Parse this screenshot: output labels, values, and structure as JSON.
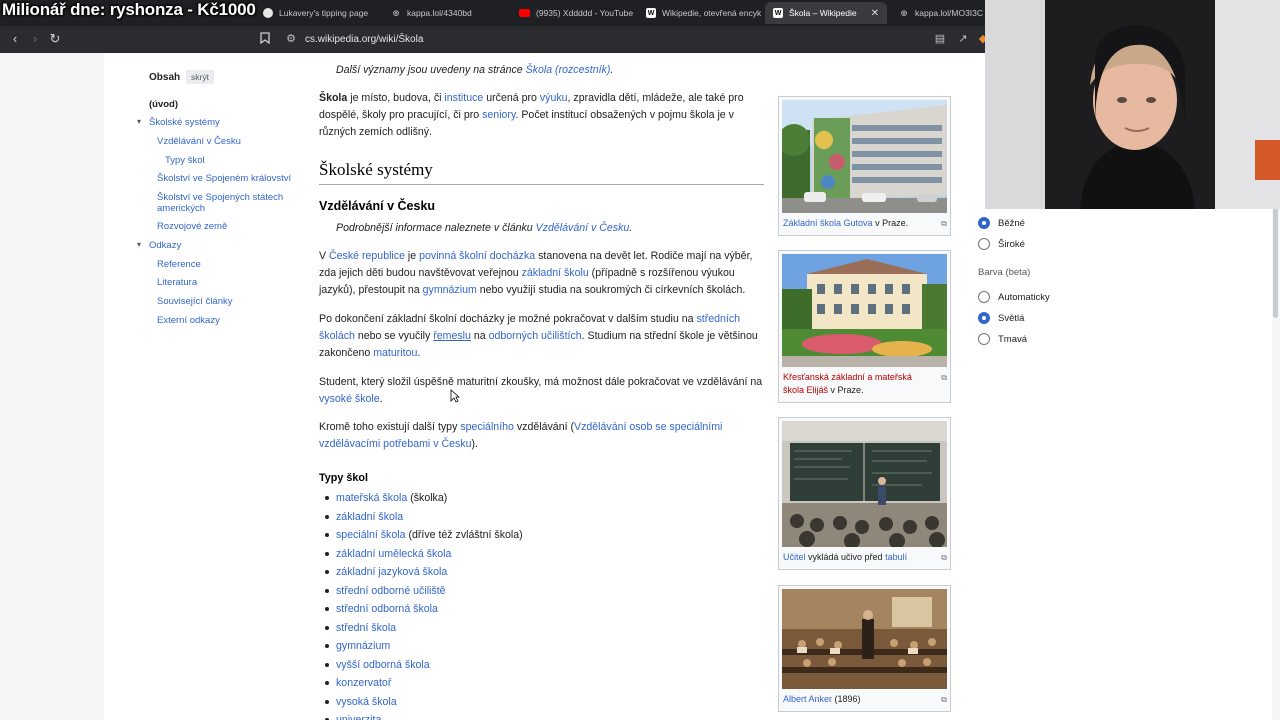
{
  "stream_title": "Milionář dne: ryshonza - Kč1000",
  "tabs": [
    {
      "label": "Lukavery's tipping page",
      "icon": "tipping-icon",
      "active": false
    },
    {
      "label": "kappa.lol/4340bd",
      "icon": "globe-icon",
      "active": false
    },
    {
      "label": "(9935) Xddddd - YouTube",
      "icon": "youtube-icon",
      "active": false
    },
    {
      "label": "Wikipedie, otevřená encyk",
      "icon": "wikipedia-icon",
      "active": false
    },
    {
      "label": "Škola – Wikipedie",
      "icon": "wikipedia-icon",
      "active": true
    },
    {
      "label": "kappa.lol/MO3I3C",
      "icon": "globe-icon",
      "active": false
    }
  ],
  "address": {
    "url": "cs.wikipedia.org/wiki/Škola"
  },
  "toc": {
    "title": "Obsah",
    "hide_label": "skrýt",
    "items": [
      {
        "label": "(úvod)",
        "level": 0
      },
      {
        "label": "Školské systémy",
        "level": 0
      },
      {
        "label": "Vzdělávání v Česku",
        "level": 1
      },
      {
        "label": "Typy škol",
        "level": 2
      },
      {
        "label": "Školství ve Spojeném království",
        "level": 1
      },
      {
        "label": "Školství ve Spojených státech amerických",
        "level": 1
      },
      {
        "label": "Rozvojové země",
        "level": 1
      },
      {
        "label": "Odkazy",
        "level": 0
      },
      {
        "label": "Reference",
        "level": 1
      },
      {
        "label": "Literatura",
        "level": 1
      },
      {
        "label": "Související články",
        "level": 1
      },
      {
        "label": "Externí odkazy",
        "level": 1
      }
    ]
  },
  "article": {
    "hatnote_top": {
      "text": "Další významy jsou uvedeny na stránce ",
      "link": "Škola (rozcestník)",
      "end": "."
    },
    "intro": {
      "t1": "Škola",
      "t2": " je místo, budova, či ",
      "l1": "instituce",
      "t3": " určená pro ",
      "l2": "výuku",
      "t4": ", zpravidla dětí, mládeže, ale také pro dospělé, školy pro pracující, či pro ",
      "l3": "seniory",
      "t5": ". Počet institucí obsažených v pojmu škola je v různých zemích odlišný."
    },
    "h2": "Školské systémy",
    "h3": "Vzdělávání v Česku",
    "hatnote_cz": {
      "text": "Podrobnější informace naleznete v článku ",
      "link": "Vzdělávání v Česku",
      "end": "."
    },
    "p1": {
      "t1": "V ",
      "l1": "České republice",
      "t2": " je ",
      "l2": "povinná školní docházka",
      "t3": " stanovena na devět let. Rodiče mají na výběr, zda jejich děti budou navštěvovat veřejnou ",
      "l3": "základní školu",
      "t4": " (případně s rozšířenou výukou jazyků), přestoupit na ",
      "l4": "gymnázium",
      "t5": " nebo využijí studia na soukromých či církevních školách."
    },
    "p2": {
      "t1": "Po dokončení základní školní docházky je možné pokračovat v dalším studiu na ",
      "l1": "středních školách",
      "t2": " nebo se vyučily ",
      "l2": "řemeslu",
      "t3": " na ",
      "l3": "odborných učilištích",
      "t4": ". Studium na střední škole je většinou zakončeno ",
      "l4": "maturitou",
      "t5": "."
    },
    "p3": {
      "t1": "Student, který složil úspěšně maturitní zkoušky, má možnost dále pokračovat ve vzdělávání na ",
      "l1": "vysoké škole",
      "t2": "."
    },
    "p4": {
      "t1": "Kromě toho existují další typy ",
      "l1": "speciálního",
      "t2": " vzdělávání (",
      "l2": "Vzdělávání osob se speciálními vzdělávacími potřebami v Česku",
      "t3": ")."
    },
    "h4": "Typy škol",
    "types": [
      {
        "label": "mateřská škola",
        "suffix": " (školka)",
        "red": false
      },
      {
        "label": "základní škola",
        "suffix": "",
        "red": false
      },
      {
        "label": "speciální škola",
        "suffix": " (dříve též zvláštní škola)",
        "red": false
      },
      {
        "label": "základní umělecká škola",
        "suffix": "",
        "red": false
      },
      {
        "label": "základní jazyková škola",
        "suffix": "",
        "red": true
      },
      {
        "label": "střední odborné učiliště",
        "suffix": "",
        "red": false
      },
      {
        "label": "střední odborná škola",
        "suffix": "",
        "red": false
      },
      {
        "label": "střední škola",
        "suffix": "",
        "red": false
      },
      {
        "label": "gymnázium",
        "suffix": "",
        "red": false
      },
      {
        "label": "vyšší odborná škola",
        "suffix": "",
        "red": false
      },
      {
        "label": "konzervatoř",
        "suffix": "",
        "red": false
      },
      {
        "label": "vysoká škola",
        "suffix": "",
        "red": false
      },
      {
        "label": "univerzita",
        "suffix": "",
        "red": false
      }
    ]
  },
  "images": [
    {
      "cap_link": "Základní škola Gutova",
      "cap_text": " v Praze."
    },
    {
      "cap_link": "Křesťanská základní a mateřská škola Elijáš",
      "cap_text": " v Praze."
    },
    {
      "cap_link": "Učitel",
      "cap_text": " vykládá učivo před ",
      "cap_link2": "tabulí"
    },
    {
      "cap_link": "Albert Anker",
      "cap_text": " (1896)"
    }
  ],
  "appearance": {
    "width_options": [
      {
        "label": "Běžné",
        "checked": true
      },
      {
        "label": "Široké",
        "checked": false
      }
    ],
    "color_label": "Barva (beta)",
    "color_options": [
      {
        "label": "Automaticky",
        "checked": false
      },
      {
        "label": "Světlá",
        "checked": true
      },
      {
        "label": "Tmavá",
        "checked": false
      }
    ]
  }
}
